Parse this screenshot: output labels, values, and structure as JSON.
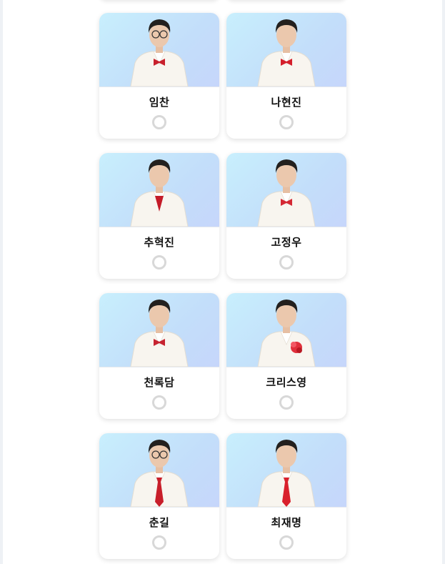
{
  "candidates": [
    {
      "name": "임찬",
      "tie_color": "#c8202c",
      "accessory": "bow",
      "glasses": true
    },
    {
      "name": "나현진",
      "tie_color": "#d41f2b",
      "accessory": "bow",
      "glasses": false
    },
    {
      "name": "추혁진",
      "tie_color": "#c41b28",
      "accessory": "shirt",
      "glasses": false
    },
    {
      "name": "고정우",
      "tie_color": "#d42834",
      "accessory": "bow",
      "glasses": false
    },
    {
      "name": "천록담",
      "tie_color": "#c62330",
      "accessory": "bow",
      "glasses": false
    },
    {
      "name": "크리스영",
      "tie_color": "#e0303c",
      "accessory": "flower",
      "glasses": false
    },
    {
      "name": "춘길",
      "tie_color": "#c81e2a",
      "accessory": "tie",
      "glasses": true
    },
    {
      "name": "최재명",
      "tie_color": "#d9202c",
      "accessory": "tie",
      "glasses": false
    }
  ]
}
